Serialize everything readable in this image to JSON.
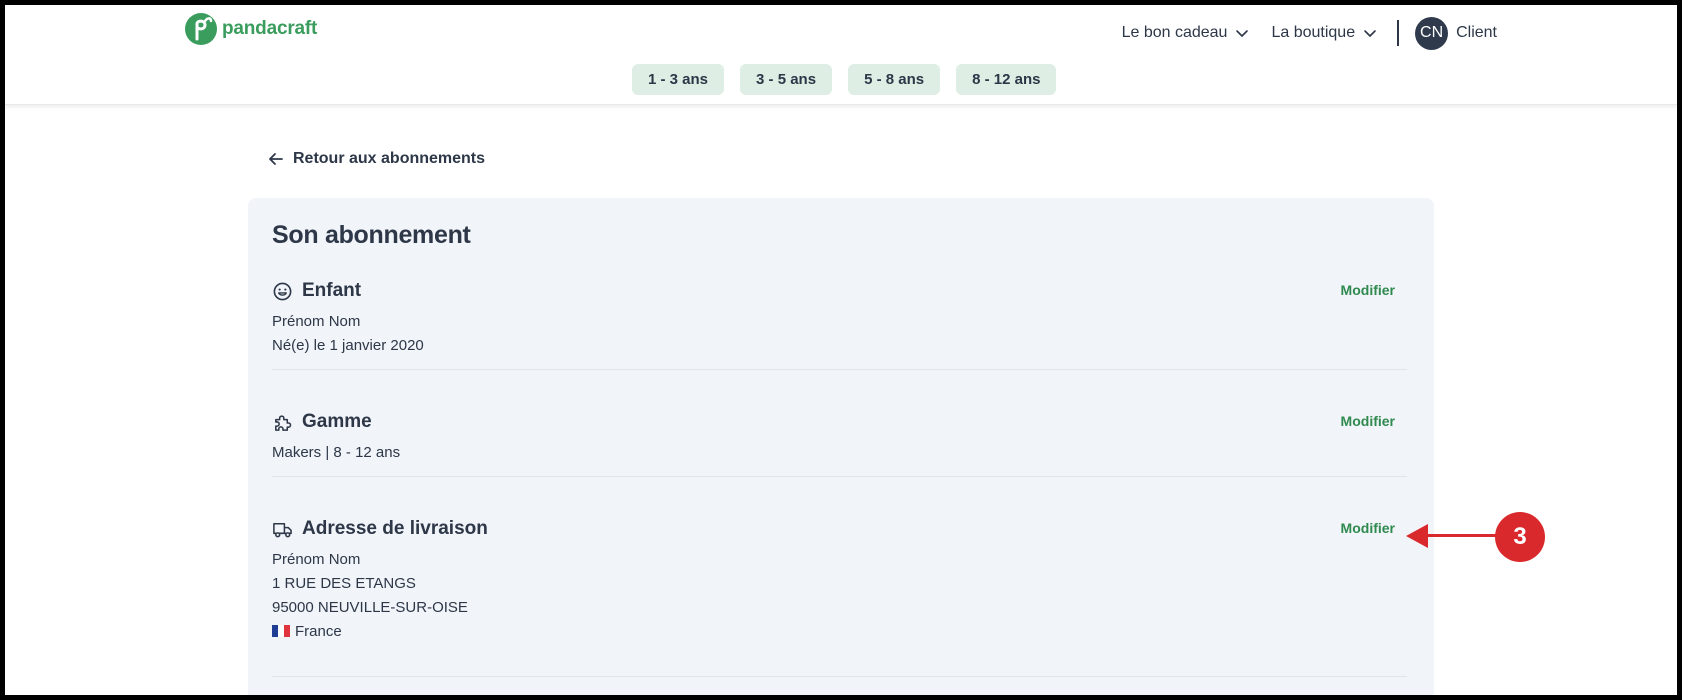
{
  "brand": {
    "name": "pandacraft",
    "color": "#3a9d5d"
  },
  "nav": {
    "items": [
      {
        "label": "Le bon cadeau"
      },
      {
        "label": "La boutique"
      }
    ],
    "avatar_initials": "CN",
    "client_label": "Client"
  },
  "age_tabs": [
    "1 - 3 ans",
    "3 - 5 ans",
    "5 - 8 ans",
    "8 - 12 ans"
  ],
  "back_link": "Retour aux abonnements",
  "card": {
    "title": "Son abonnement",
    "sections": {
      "enfant": {
        "icon": "smiley-icon",
        "title": "Enfant",
        "lines": [
          "Prénom Nom",
          "Né(e) le 1 janvier 2020"
        ],
        "action": "Modifier"
      },
      "gamme": {
        "icon": "puzzle-icon",
        "title": "Gamme",
        "lines": [
          "Makers | 8 - 12 ans"
        ],
        "action": "Modifier"
      },
      "adresse": {
        "icon": "truck-icon",
        "title": "Adresse de livraison",
        "lines": [
          "Prénom Nom",
          "1 RUE DES ETANGS",
          "95000 NEUVILLE-SUR-OISE"
        ],
        "country": "France",
        "action": "Modifier"
      }
    }
  },
  "annotation": {
    "number": "3",
    "color": "#d9292c"
  }
}
